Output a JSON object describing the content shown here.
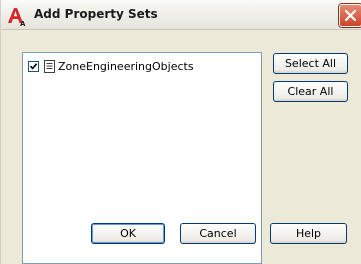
{
  "dialog": {
    "title": "Add Property Sets"
  },
  "property_sets": [
    {
      "label": "ZoneEngineeringObjects",
      "checked": true
    }
  ],
  "buttons": {
    "select_all": "Select All",
    "clear_all": "Clear All",
    "ok": "OK",
    "cancel": "Cancel",
    "help": "Help"
  },
  "icons": {
    "app": "autocad-architecture-icon",
    "close": "close-icon",
    "item": "property-set-icon"
  },
  "colors": {
    "close_button": "#d65a3c",
    "app_icon": "#d8242b"
  }
}
